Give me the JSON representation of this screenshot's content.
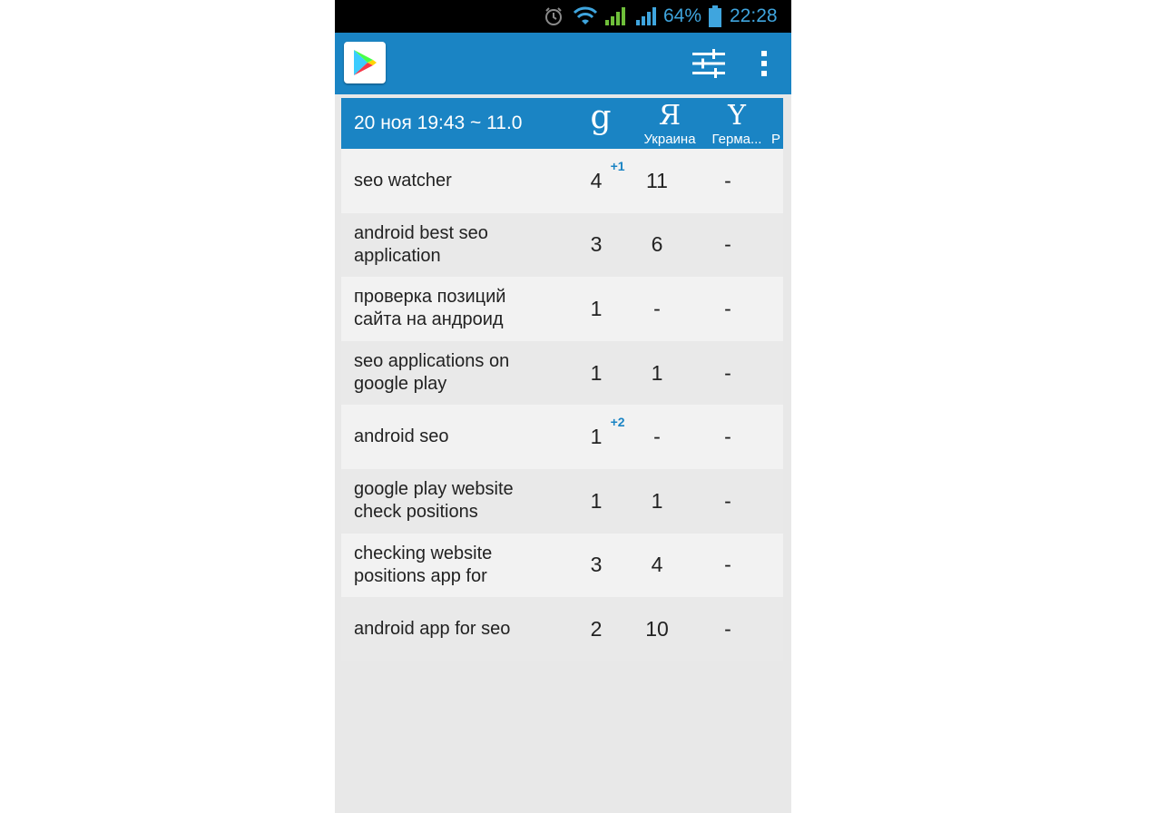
{
  "status_bar": {
    "battery": "64%",
    "time": "22:28"
  },
  "app_bar": {
    "logo_icon": "google-play-icon",
    "filter_icon": "sliders-icon",
    "menu_icon": "more-vertical-icon"
  },
  "table": {
    "header": {
      "date_label": "20 ноя 19:43 ~ 11.0",
      "columns": [
        {
          "glyph": "g",
          "region": ""
        },
        {
          "glyph": "Я",
          "region": "Украина"
        },
        {
          "glyph": "Y",
          "region": "Герма..."
        },
        {
          "glyph": "",
          "region": "P"
        }
      ]
    },
    "rows": [
      {
        "keyword": "seo watcher",
        "google": "4",
        "google_delta": "+1",
        "yandex": "11",
        "yahoo": "-"
      },
      {
        "keyword": "android best seo application",
        "google": "3",
        "google_delta": "",
        "yandex": "6",
        "yahoo": "-"
      },
      {
        "keyword": "проверка позиций сайта на андроид",
        "google": "1",
        "google_delta": "",
        "yandex": "-",
        "yahoo": "-"
      },
      {
        "keyword": "seo applications on google play",
        "google": "1",
        "google_delta": "",
        "yandex": "1",
        "yahoo": "-"
      },
      {
        "keyword": "android seo",
        "google": "1",
        "google_delta": "+2",
        "yandex": "-",
        "yahoo": "-"
      },
      {
        "keyword": "google play website check positions",
        "google": "1",
        "google_delta": "",
        "yandex": "1",
        "yahoo": "-"
      },
      {
        "keyword": "checking website positions app for",
        "google": "3",
        "google_delta": "",
        "yandex": "4",
        "yahoo": "-"
      },
      {
        "keyword": "android app for seo",
        "google": "2",
        "google_delta": "",
        "yandex": "10",
        "yahoo": "-"
      }
    ]
  },
  "colors": {
    "accent": "#1a84c4",
    "status_icons": "#3fa5de",
    "row_light": "#f2f2f2",
    "row_dark": "#e9e9e9"
  }
}
